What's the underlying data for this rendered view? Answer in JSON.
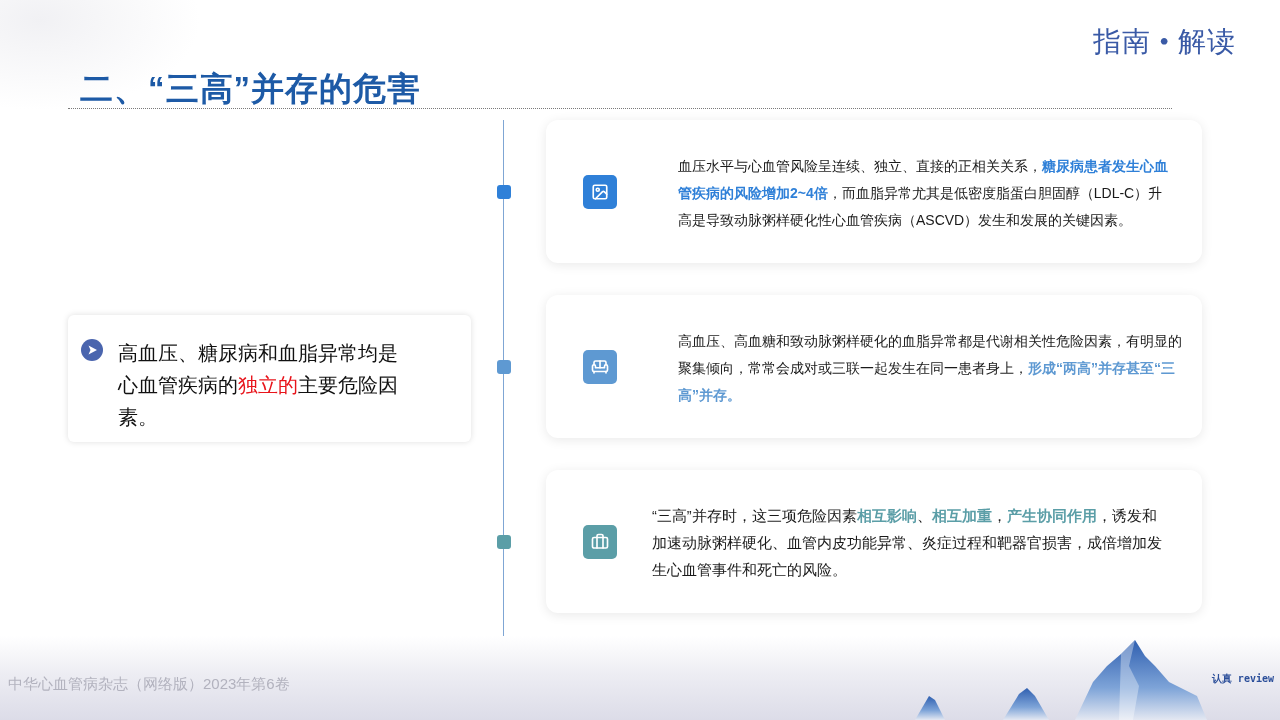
{
  "header": {
    "badge": "指南 • 解读",
    "title": "二、“三高”并存的危害"
  },
  "summary": {
    "segments": [
      {
        "text": "高血压、糖尿病和血脂异常均是心血管疾病的",
        "highlight": false
      },
      {
        "text": "独立的",
        "highlight": true
      },
      {
        "text": "主要危险因素。",
        "highlight": false
      }
    ]
  },
  "points": [
    {
      "kind": "image",
      "color": "#2f80d8",
      "text": "血压水平与心血管风险呈连续、独立、直接的正相关关系，**糖尿病患者发生心血管疾病的风险增加2~4倍**，而血脂异常尤其是低密度脂蛋白胆固醇（LDL-C）升高是导致动脉粥样硬化性心血管疾病（ASCVD）发生和发展的关键因素。"
    },
    {
      "kind": "sofa",
      "color": "#5e99d2",
      "text": "高血压、高血糖和致动脉粥样硬化的血脂异常都是代谢相关性危险因素，有明显的聚集倾向，常常会成对或三联一起发生在同一患者身上，**形成“两高”并存甚至“三高”并存。**"
    },
    {
      "kind": "briefcase",
      "color": "#5b9ea7",
      "text": "“三高”并存时，这三项危险因素**相互影响**、**相互加重**，**产生协同作用**，诱发和加速动脉粥样硬化、血管内皮功能异常、炎症过程和靶器官损害，成倍增加发生心血管事件和死亡的风险。"
    }
  ],
  "footer": {
    "journal": "中华心血管病杂志（网络版）2023年第6卷",
    "signature": "认真 review"
  }
}
